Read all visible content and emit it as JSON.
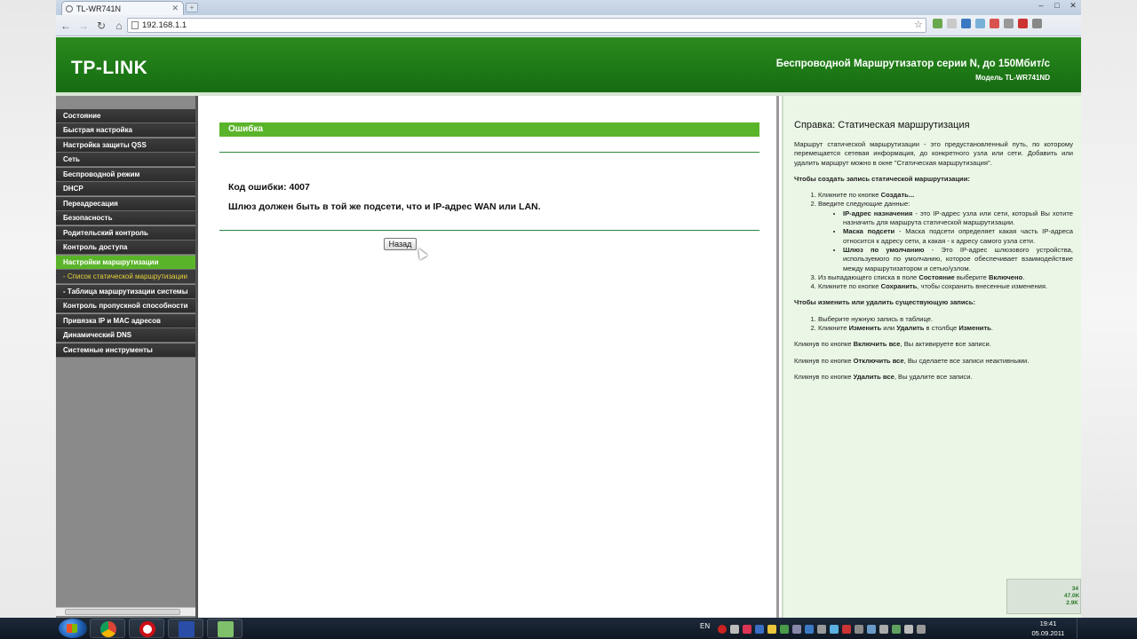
{
  "browser": {
    "tab_title": "TL-WR741N",
    "url": "192.168.1.1"
  },
  "header": {
    "logo": "TP-LINK",
    "title": "Беспроводной Маршрутизатор серии N, до 150Мбит/с",
    "model": "Модель TL-WR741ND"
  },
  "sidebar": {
    "items": [
      {
        "label": "Состояние"
      },
      {
        "label": "Быстрая настройка"
      },
      {
        "label": "Настройка защиты QSS"
      },
      {
        "label": "Сеть"
      },
      {
        "label": "Беспроводной режим"
      },
      {
        "label": "DHCP"
      },
      {
        "label": "Переадресация"
      },
      {
        "label": "Безопасность"
      },
      {
        "label": "Родительский контроль"
      },
      {
        "label": "Контроль доступа"
      },
      {
        "label": "Настройки маршрутизации"
      },
      {
        "label": "- Список статической маршрутизации"
      },
      {
        "label": "- Таблица маршрутизации системы"
      },
      {
        "label": "Контроль пропускной способности"
      },
      {
        "label": "Привязка IP и MAC адресов"
      },
      {
        "label": "Динамический DNS"
      },
      {
        "label": "Системные инструменты"
      }
    ]
  },
  "main": {
    "error_title": "Ошибка",
    "error_code": "Код ошибки: 4007",
    "error_message": "Шлюз должен быть в той же подсети, что и IP-адрес WAN или LAN.",
    "back_button": "Назад"
  },
  "help": {
    "title": "Справка: Статическая маршрутизация",
    "intro": "Маршрут статической маршрутизации - это предустановленный путь, по которому перемещается сетевая информация, до конкретного узла или сети. Добавить или удалить маршрут можно в окне \"Статическая маршрутизация\".",
    "create_heading": "Чтобы создать запись статической маршрутизации:",
    "create_step1_pre": "Кликните по кнопке ",
    "create_step1_bold": "Создать...",
    "create_step2": "Введите следующие данные:",
    "field1_name": "IP-адрес назначения",
    "field1_desc": " - это IP-адрес узла или сети, который Вы хотите назначить для маршрута статической маршрутизации.",
    "field2_name": "Маска подсети",
    "field2_desc": " - Маска подсети определяет какая часть IP-адреса относится к адресу сети, а какая - к адресу самого узла сети.",
    "field3_name": "Шлюз по умолчанию",
    "field3_desc": " - Это IP-адрес шлюзового устройства, используемого по умолчанию, которое обеспечивает взаимодействие между маршрутизатором и сетью/узлом.",
    "create_step3_pre": "Из выпадающего списка в поле ",
    "create_step3_b1": "Состояние",
    "create_step3_mid": " выберите ",
    "create_step3_b2": "Включено",
    "create_step4_pre": "Кликните по кнопке ",
    "create_step4_bold": "Сохранить",
    "create_step4_post": ", чтобы сохранить внесенные изменения.",
    "edit_heading": "Чтобы изменить или удалить существующую запись:",
    "edit_step1": "Выберите нужную запись в таблице.",
    "edit_step2_pre": "Кликните ",
    "edit_step2_b1": "Изменить",
    "edit_step2_mid": " или ",
    "edit_step2_b2": "Удалить",
    "edit_step2_mid2": " в столбце ",
    "edit_step2_b3": "Изменить",
    "enable_pre": "Кликнув по кнопке ",
    "enable_bold": "Включить все",
    "enable_post": ", Вы активируете все записи.",
    "disable_pre": "Кликнув по кнопке ",
    "disable_bold": "Отключить все",
    "disable_post": ", Вы сделаете все записи неактивными.",
    "delete_pre": "Кликнув по кнопке ",
    "delete_bold": "Удалить все",
    "delete_post": ", Вы удалите все записи."
  },
  "widget": {
    "line1": "34",
    "line2": "47.0K",
    "line3": "2.9K"
  },
  "taskbar": {
    "language": "EN",
    "time": "19:41",
    "date": "05.09.2011"
  },
  "colors": {
    "banner_green": "#1e7a16",
    "accent_green": "#5ab42a",
    "help_bg": "#eaf6e6",
    "menu_dark": "#2c2c2c"
  }
}
